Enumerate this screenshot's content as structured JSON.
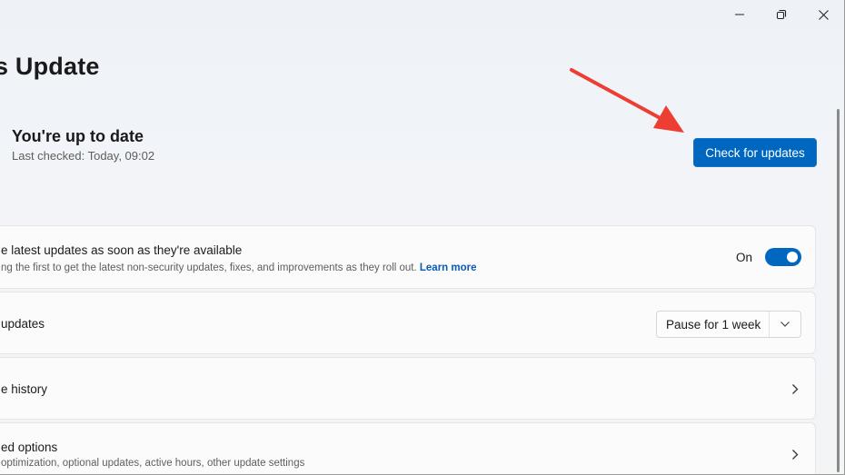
{
  "window": {
    "minimize_label": "minimize",
    "maximize_label": "maximize",
    "close_label": "close"
  },
  "page": {
    "title": "s Update"
  },
  "status": {
    "title": "You're up to date",
    "last_checked": "Last checked: Today, 09:02",
    "check_button": "Check for updates"
  },
  "cards": {
    "latest_updates": {
      "title": "e latest updates as soon as they're available",
      "desc": "ng the first to get the latest non-security updates, fixes, and improvements as they roll out.",
      "learn_more": "Learn more",
      "toggle_label": "On",
      "toggle_on": true
    },
    "pause": {
      "title": "updates",
      "dropdown_value": "Pause for 1 week"
    },
    "history": {
      "title": "e history"
    },
    "advanced": {
      "title": "ed options",
      "desc": "optimization, optional updates, active hours, other update settings"
    }
  },
  "colors": {
    "accent": "#0067c0",
    "arrow": "#ee3e34",
    "link": "#0a5bb5"
  },
  "icons": {
    "minimize": "minimize-icon",
    "maximize": "restore-icon",
    "close": "close-icon",
    "chevron_down": "chevron-down-icon",
    "chevron_right": "chevron-right-icon",
    "annotation": "red-arrow"
  }
}
